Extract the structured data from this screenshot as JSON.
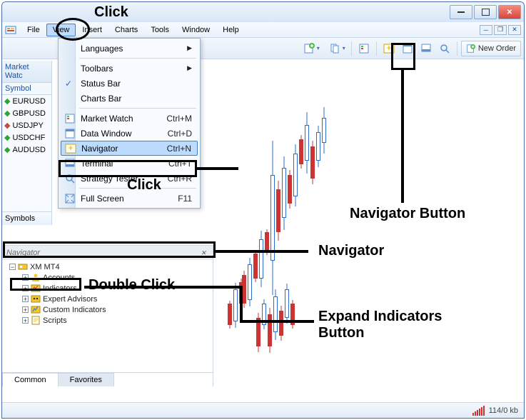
{
  "window": {
    "min_tip": "Minimize",
    "max_tip": "Maximize",
    "close_tip": "Close"
  },
  "menubar": {
    "items": [
      "File",
      "View",
      "Insert",
      "Charts",
      "Tools",
      "Window",
      "Help"
    ],
    "active_index": 1
  },
  "inner_controls": [
    "min",
    "restore",
    "close"
  ],
  "toolbar": {
    "new_order_label": "New Order"
  },
  "market_watch": {
    "title": "Market Watc",
    "header": "Symbol",
    "rows": [
      {
        "dir": "up",
        "symbol": "EURUSD"
      },
      {
        "dir": "up",
        "symbol": "GBPUSD"
      },
      {
        "dir": "dn",
        "symbol": "USDJPY"
      },
      {
        "dir": "up",
        "symbol": "USDCHF"
      },
      {
        "dir": "up",
        "symbol": "AUDUSD"
      }
    ],
    "symbols_tab": "Symbols"
  },
  "view_menu": {
    "items": [
      {
        "kind": "sub",
        "label": "Languages"
      },
      {
        "kind": "sep"
      },
      {
        "kind": "sub",
        "label": "Toolbars"
      },
      {
        "kind": "check",
        "label": "Status Bar",
        "checked": true
      },
      {
        "kind": "plain",
        "label": "Charts Bar"
      },
      {
        "kind": "sep"
      },
      {
        "kind": "cmd",
        "icon": "market",
        "label": "Market Watch",
        "shortcut": "Ctrl+M"
      },
      {
        "kind": "cmd",
        "icon": "data",
        "label": "Data Window",
        "shortcut": "Ctrl+D"
      },
      {
        "kind": "cmd",
        "icon": "nav",
        "label": "Navigator",
        "shortcut": "Ctrl+N",
        "highlight": true
      },
      {
        "kind": "cmd",
        "icon": "terminal",
        "label": "Terminal",
        "shortcut": "Ctrl+T"
      },
      {
        "kind": "cmd",
        "icon": "strategy",
        "label": "Strategy Tester",
        "shortcut": "Ctrl+R"
      },
      {
        "kind": "sep"
      },
      {
        "kind": "cmd",
        "icon": "fullscreen",
        "label": "Full Screen",
        "shortcut": "F11"
      }
    ]
  },
  "navigator": {
    "title": "Navigator",
    "root": "XM MT4",
    "children": [
      {
        "icon": "accounts",
        "label": "Accounts"
      },
      {
        "icon": "indicators",
        "label": "Indicators"
      },
      {
        "icon": "experts",
        "label": "Expert Advisors"
      },
      {
        "icon": "custom",
        "label": "Custom Indicators"
      },
      {
        "icon": "scripts",
        "label": "Scripts"
      }
    ],
    "tabs": [
      "Common",
      "Favorites"
    ],
    "active_tab": 0
  },
  "status": {
    "rate": "114/0 kb"
  },
  "annotations": {
    "click_view": "Click",
    "click_navigator": "Click",
    "navigator_button": "Navigator Button",
    "navigator_panel": "Navigator",
    "double_click": "Double Click",
    "expand_btn": "Expand Indicators\nButton"
  },
  "icons": {
    "nav_toolbar": "nav-icon"
  }
}
